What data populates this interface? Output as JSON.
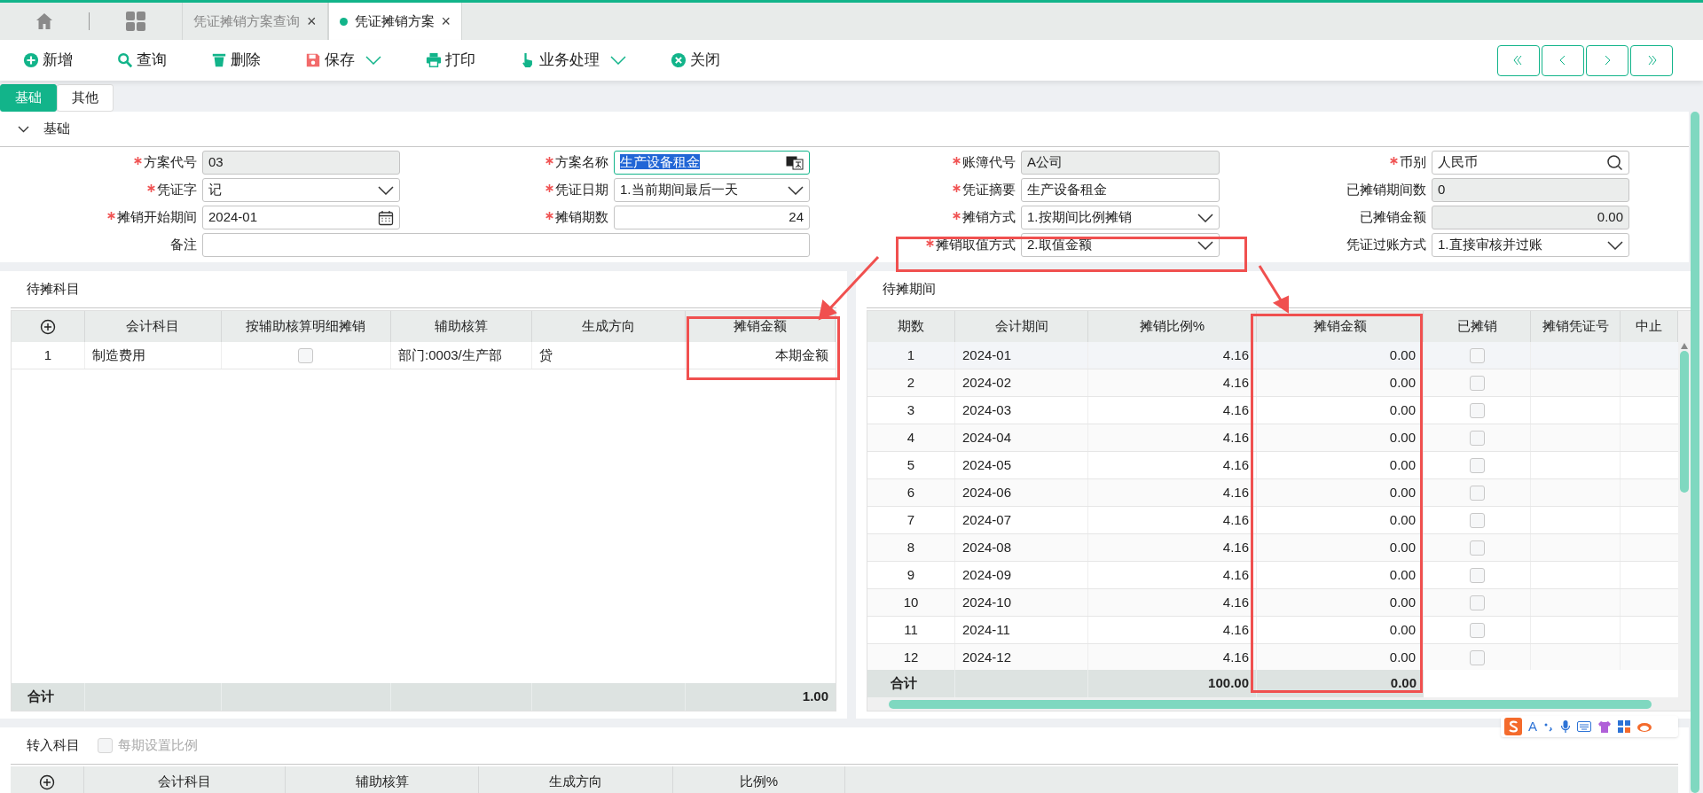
{
  "tabs": [
    {
      "label": "凭证摊销方案查询",
      "selected": false,
      "close": "×"
    },
    {
      "label": "凭证摊销方案",
      "selected": true,
      "close": "×"
    }
  ],
  "toolbar": [
    {
      "label": "新增",
      "dropdown": false
    },
    {
      "label": "查询",
      "dropdown": false
    },
    {
      "label": "删除",
      "dropdown": false
    },
    {
      "label": "保存",
      "dropdown": true
    },
    {
      "label": "打印",
      "dropdown": false
    },
    {
      "label": "业务处理",
      "dropdown": true
    },
    {
      "label": "关闭",
      "dropdown": false
    }
  ],
  "subtabs": [
    {
      "label": "基础",
      "selected": true
    },
    {
      "label": "其他",
      "selected": false
    }
  ],
  "section": {
    "title": "基础",
    "expanded": true
  },
  "form": {
    "rows": [
      [
        {
          "label": "方案代号",
          "required": true,
          "kind": "readonly",
          "value": "03"
        },
        {
          "label": "方案名称",
          "required": true,
          "kind": "text",
          "value": "生产设备租金",
          "highlighted": true
        },
        {
          "label": "账簿代号",
          "required": true,
          "kind": "readonly",
          "value": "A公司"
        },
        {
          "label": "币别",
          "required": true,
          "kind": "search",
          "value": "人民币"
        }
      ],
      [
        {
          "label": "凭证字",
          "required": true,
          "kind": "select",
          "value": "记"
        },
        {
          "label": "凭证日期",
          "required": true,
          "kind": "select",
          "value": "1.当前期间最后一天"
        },
        {
          "label": "凭证摘要",
          "required": true,
          "kind": "text",
          "value": "生产设备租金"
        },
        {
          "label": "已摊销期间数",
          "required": false,
          "kind": "readonly",
          "value": "0"
        }
      ],
      [
        {
          "label": "摊销开始期间",
          "required": true,
          "kind": "date",
          "value": "2024-01"
        },
        {
          "label": "摊销期数",
          "required": true,
          "kind": "number",
          "value": "24"
        },
        {
          "label": "摊销方式",
          "required": true,
          "kind": "select",
          "value": "1.按期间比例摊销"
        },
        {
          "label": "已摊销金额",
          "required": false,
          "kind": "readonly_number",
          "value": "0.00"
        }
      ],
      [
        {
          "label": "备注",
          "required": false,
          "kind": "text"
        },
        "",
        {
          "label": "摊销取值方式",
          "required": true,
          "kind": "select",
          "value": "2.取值金额"
        },
        {
          "label": "凭证过账方式",
          "required": false,
          "kind": "select",
          "value": "1.直接审核并过账"
        }
      ]
    ]
  },
  "pending_accounts": {
    "title": "待摊科目",
    "columns": [
      "会计科目",
      "按辅助核算明细摊销",
      "辅助核算",
      "生成方向",
      "摊销金额"
    ],
    "rows": [
      {
        "no": "1",
        "account": "制造费用",
        "by_detail": false,
        "aux": "部门:0003/生产部",
        "direction": "贷",
        "amount": "本期金额"
      }
    ],
    "total": {
      "label": "合计",
      "amount": "1.00"
    }
  },
  "pending_periods": {
    "title": "待摊期间",
    "columns": [
      "期数",
      "会计期间",
      "摊销比例%",
      "摊销金额",
      "已摊销",
      "摊销凭证号",
      "中止"
    ],
    "rows": [
      {
        "no": "1",
        "period": "2024-01",
        "ratio": "4.16",
        "amount": "0.00",
        "done": false
      },
      {
        "no": "2",
        "period": "2024-02",
        "ratio": "4.16",
        "amount": "0.00",
        "done": false
      },
      {
        "no": "3",
        "period": "2024-03",
        "ratio": "4.16",
        "amount": "0.00",
        "done": false
      },
      {
        "no": "4",
        "period": "2024-04",
        "ratio": "4.16",
        "amount": "0.00",
        "done": false
      },
      {
        "no": "5",
        "period": "2024-05",
        "ratio": "4.16",
        "amount": "0.00",
        "done": false
      },
      {
        "no": "6",
        "period": "2024-06",
        "ratio": "4.16",
        "amount": "0.00",
        "done": false
      },
      {
        "no": "7",
        "period": "2024-07",
        "ratio": "4.16",
        "amount": "0.00",
        "done": false
      },
      {
        "no": "8",
        "period": "2024-08",
        "ratio": "4.16",
        "amount": "0.00",
        "done": false
      },
      {
        "no": "9",
        "period": "2024-09",
        "ratio": "4.16",
        "amount": "0.00",
        "done": false
      },
      {
        "no": "10",
        "period": "2024-10",
        "ratio": "4.16",
        "amount": "0.00",
        "done": false
      },
      {
        "no": "11",
        "period": "2024-11",
        "ratio": "4.16",
        "amount": "0.00",
        "done": false
      },
      {
        "no": "12",
        "period": "2024-12",
        "ratio": "4.16",
        "amount": "0.00",
        "done": false
      }
    ],
    "total": {
      "label": "合计",
      "ratio": "100.00",
      "amount": "0.00"
    }
  },
  "transfer": {
    "title": "转入科目",
    "per_period": {
      "label": "每期设置比例",
      "checked": false,
      "disabled": true
    },
    "columns": [
      "会计科目",
      "辅助核算",
      "生成方向",
      "比例%"
    ]
  },
  "ime_toolbar": {
    "letter": "A"
  }
}
